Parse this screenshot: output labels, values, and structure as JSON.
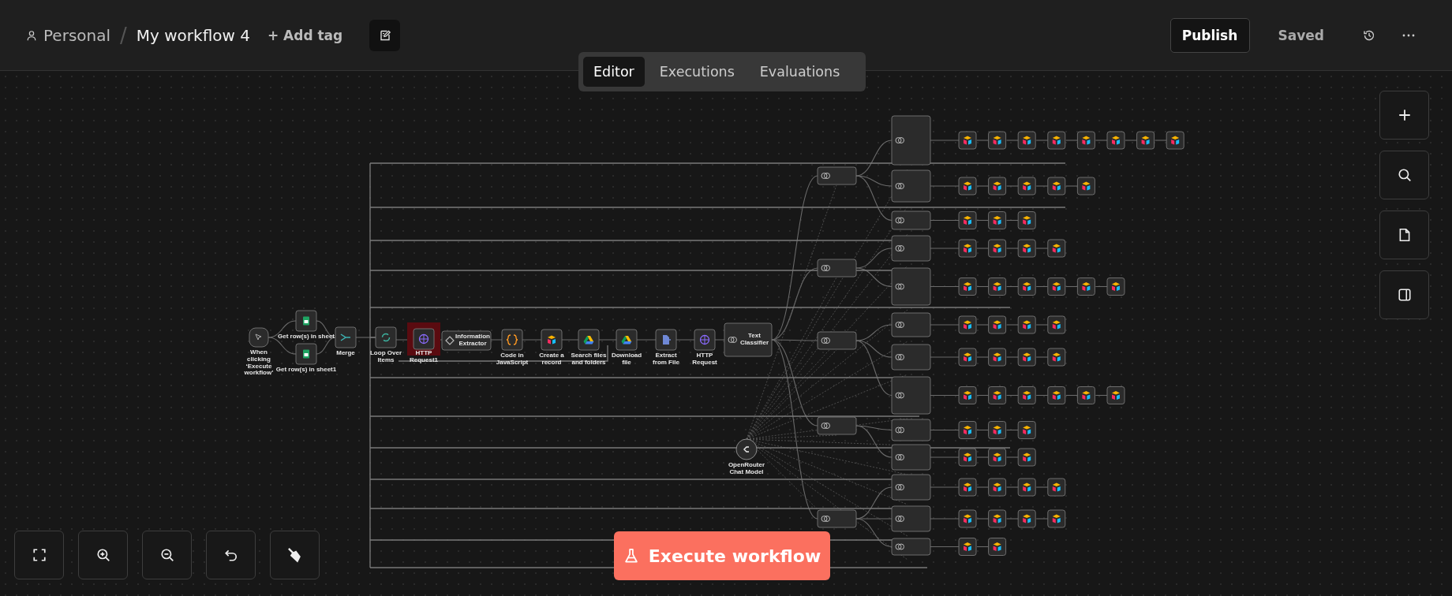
{
  "breadcrumb": {
    "project": "Personal",
    "separator": "/",
    "workflow": "My workflow 4"
  },
  "add_tag": "+ Add tag",
  "header_actions": {
    "publish": "Publish",
    "status": "Saved"
  },
  "tabs": [
    {
      "label": "Editor",
      "selected": true
    },
    {
      "label": "Executions",
      "selected": false
    },
    {
      "label": "Evaluations",
      "selected": false
    }
  ],
  "canvas": {
    "nodes": [
      {
        "kind": "trigger",
        "label": "When clicking ‘Execute workflow’",
        "highlighted": false
      },
      {
        "kind": "sheets",
        "label": "Get row(s) in sheet",
        "highlighted": false
      },
      {
        "kind": "sheets",
        "label": "Get row(s) in sheet1",
        "highlighted": false
      },
      {
        "kind": "merge",
        "label": "Merge",
        "highlighted": false
      },
      {
        "kind": "loop",
        "label": "Loop Over Items",
        "highlighted": false
      },
      {
        "kind": "http",
        "label": "HTTP Request1",
        "highlighted": true
      },
      {
        "kind": "extractor",
        "label": "Information Extractor",
        "highlighted": false
      },
      {
        "kind": "code",
        "label": "Code in JavaScript",
        "highlighted": false
      },
      {
        "kind": "airtable",
        "label": "Create a record",
        "highlighted": false
      },
      {
        "kind": "drive",
        "label": "Search files and folders",
        "highlighted": false
      },
      {
        "kind": "drive",
        "label": "Download file",
        "highlighted": false
      },
      {
        "kind": "extract",
        "label": "Extract from File",
        "highlighted": false
      },
      {
        "kind": "http",
        "label": "HTTP Request",
        "highlighted": false
      },
      {
        "kind": "classifier",
        "label": "Text Classifier",
        "highlighted": false
      },
      {
        "kind": "model",
        "label": "OpenRouter Chat Model",
        "highlighted": false
      }
    ],
    "execute_button": "Execute workflow"
  }
}
